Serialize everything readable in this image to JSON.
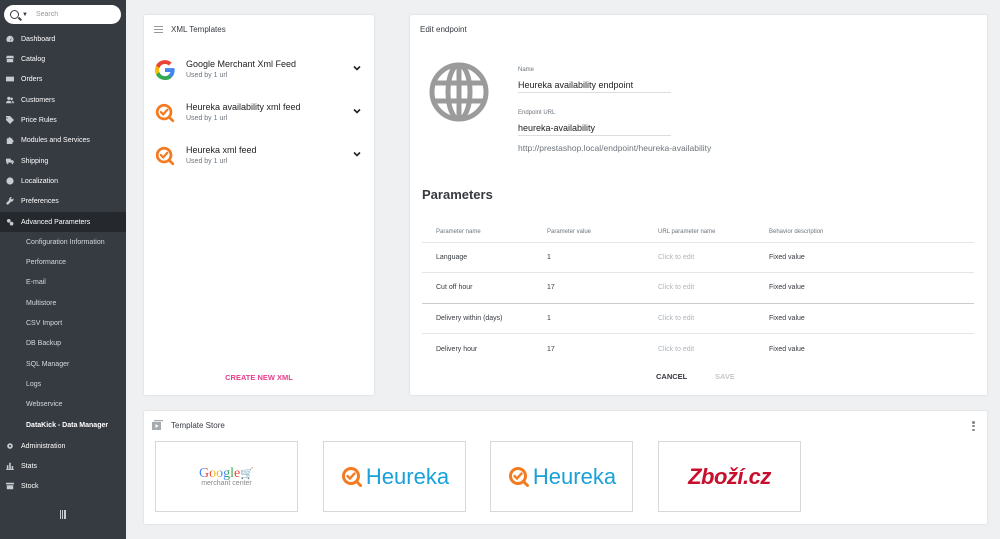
{
  "search": {
    "placeholder": "Search"
  },
  "sidebar": {
    "items": [
      {
        "label": "Dashboard",
        "icon": "dashboard-icon"
      },
      {
        "label": "Catalog",
        "icon": "store-icon"
      },
      {
        "label": "Orders",
        "icon": "credit-card-icon"
      },
      {
        "label": "Customers",
        "icon": "account-circle-icon"
      },
      {
        "label": "Price Rules",
        "icon": "tag-icon"
      },
      {
        "label": "Modules and Services",
        "icon": "puzzle-icon"
      },
      {
        "label": "Shipping",
        "icon": "truck-icon"
      },
      {
        "label": "Localization",
        "icon": "globe-icon"
      },
      {
        "label": "Preferences",
        "icon": "wrench-icon"
      },
      {
        "label": "Advanced Parameters",
        "icon": "settings-applications-icon"
      }
    ],
    "subitems": [
      "Configuration Information",
      "Performance",
      "E-mail",
      "Multistore",
      "CSV Import",
      "DB Backup",
      "SQL Manager",
      "Logs",
      "Webservice",
      "DataKick - Data Manager"
    ],
    "bottom_items": [
      {
        "label": "Administration",
        "icon": "settings-icon"
      },
      {
        "label": "Stats",
        "icon": "bar-chart-icon"
      },
      {
        "label": "Stock",
        "icon": "stock-icon"
      }
    ]
  },
  "xml_templates": {
    "title": "XML Templates",
    "items": [
      {
        "name": "Google Merchant Xml Feed",
        "used": "Used by 1 url",
        "logo": "google-icon"
      },
      {
        "name": "Heureka availability xml feed",
        "used": "Used by 1 url",
        "logo": "heureka-icon"
      },
      {
        "name": "Heureka xml feed",
        "used": "Used by 1 url",
        "logo": "heureka-icon"
      }
    ],
    "create_label": "CREATE NEW XML"
  },
  "edit_endpoint": {
    "title": "Edit endpoint",
    "name_label": "Name",
    "name_value": "Heureka availability endpoint",
    "url_label": "Endpoint URL",
    "url_value": "heureka-availability",
    "full_url": "http://prestashop.local/endpoint/heureka-availability",
    "parameters_title": "Parameters",
    "columns": [
      "Parameter name",
      "Parameter value",
      "URL parameter name",
      "Behavior description"
    ],
    "rows": [
      {
        "name": "Language",
        "value": "1",
        "url_param": "Click to edit",
        "behavior": "Fixed value"
      },
      {
        "name": "Cut off hour",
        "value": "17",
        "url_param": "Click to edit",
        "behavior": "Fixed value"
      },
      {
        "name": "Delivery within (days)",
        "value": "1",
        "url_param": "Click to edit",
        "behavior": "Fixed value"
      },
      {
        "name": "Delivery hour",
        "value": "17",
        "url_param": "Click to edit",
        "behavior": "Fixed value"
      }
    ],
    "cancel_label": "CANCEL",
    "save_label": "SAVE"
  },
  "template_store": {
    "title": "Template Store",
    "tiles": [
      {
        "brand": "Google",
        "sub": "merchant center"
      },
      {
        "brand": "Heureka"
      },
      {
        "brand": "Heureka"
      },
      {
        "brand": "Zboží.cz"
      }
    ]
  },
  "colors": {
    "sidebar_bg": "#363a41",
    "accent_pink": "#e83e8c",
    "heureka_orange": "#f47b20",
    "heureka_blue": "#1aa1d9",
    "zbozi_red": "#c8102e"
  }
}
